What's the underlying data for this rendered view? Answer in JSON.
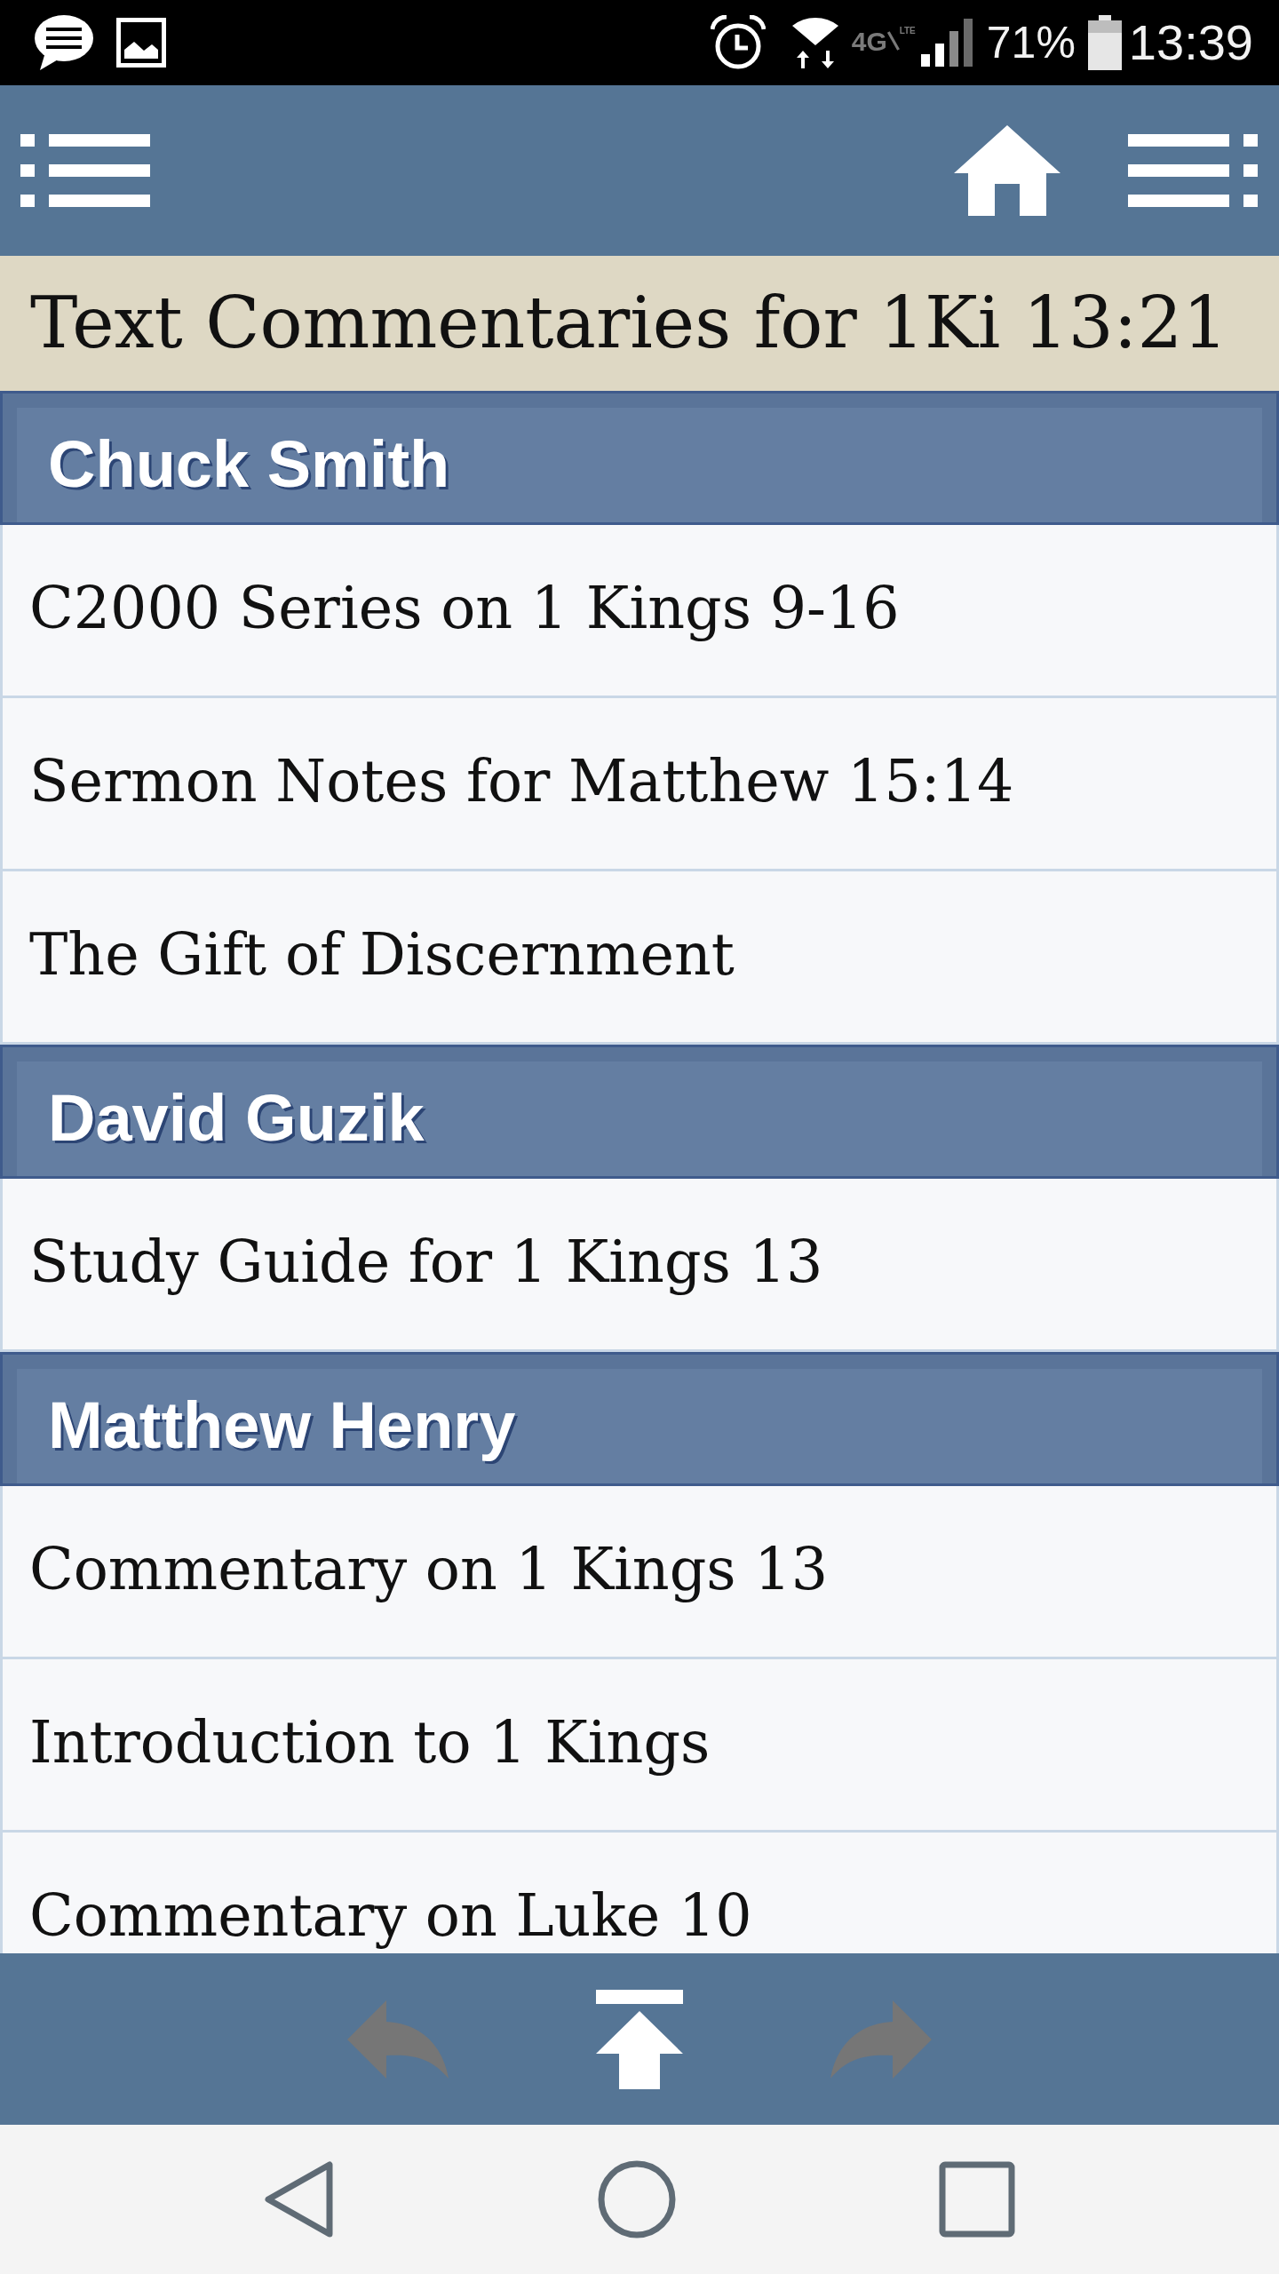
{
  "status_bar": {
    "network": "4G",
    "network_sub": "LTE",
    "battery": "71%",
    "time": "13:39"
  },
  "title": "Text Commentaries for 1Ki 13:21",
  "sections": [
    {
      "author": "Chuck Smith",
      "items": [
        "C2000 Series on 1 Kings 9-16",
        "Sermon Notes for Matthew 15:14",
        "The Gift of Discernment"
      ]
    },
    {
      "author": "David Guzik",
      "items": [
        "Study Guide for 1 Kings 13"
      ]
    },
    {
      "author": "Matthew Henry",
      "items": [
        "Commentary on 1 Kings 13",
        "Introduction to 1 Kings",
        "Commentary on Luke 10"
      ]
    }
  ],
  "bottom_toolbar": {
    "buttons": [
      {
        "kind": "back",
        "disabled": true
      },
      {
        "kind": "top",
        "disabled": false
      },
      {
        "kind": "forward",
        "disabled": true
      }
    ]
  }
}
